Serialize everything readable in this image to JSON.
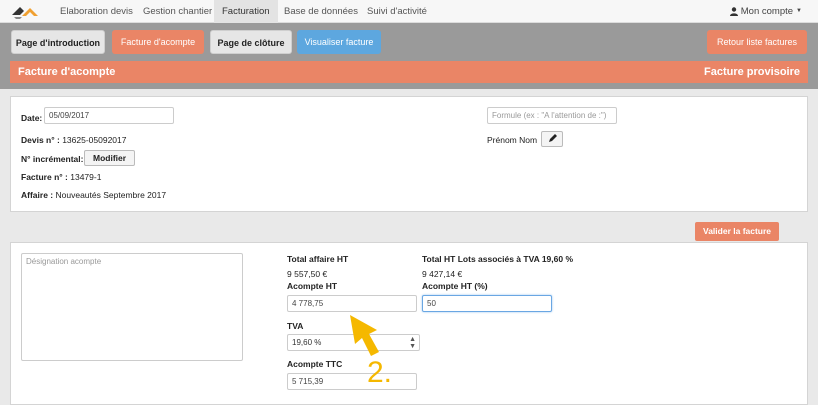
{
  "nav": {
    "tabs": [
      "Elaboration devis",
      "Gestion chantier",
      "Facturation",
      "Base de données",
      "Suivi d'activité"
    ],
    "active_index": 2,
    "account_label": "Mon compte"
  },
  "toolbar": {
    "intro": "Page d'introduction",
    "acompte": "Facture d'acompte",
    "cloture": "Page de clôture",
    "visualiser": "Visualiser facture",
    "retour": "Retour liste factures"
  },
  "title": {
    "left": "Facture d'acompte",
    "right": "Facture provisoire"
  },
  "header_form": {
    "date_label": "Date:",
    "date_value": "05/09/2017",
    "devis_label": "Devis n° :",
    "devis_value": "13625-05092017",
    "incr_label": "N° incrémental:",
    "modifier_label": "Modifier",
    "facture_label": "Facture n° :",
    "facture_value": "13479-1",
    "affaire_label": "Affaire :",
    "affaire_value": "Nouveautés Septembre 2017",
    "formule_placeholder": "Formule (ex : \"A l'attention de :\")",
    "prenom_nom": "Prénom Nom"
  },
  "validate_label": "Valider la facture",
  "acompte_form": {
    "designation_placeholder": "Désignation acompte",
    "total_affaire_label": "Total affaire HT",
    "total_affaire_value": "9 557,50 €",
    "total_lots_label": "Total HT Lots associés à TVA 19,60 %",
    "total_lots_value": "9 427,14 €",
    "acompte_ht_label": "Acompte HT",
    "acompte_ht_value": "4 778,75",
    "acompte_pct_label": "Acompte HT (%)",
    "acompte_pct_value": "50",
    "tva_label": "TVA",
    "tva_value": "19,60 %",
    "acompte_ttc_label": "Acompte TTC",
    "acompte_ttc_value": "5 715,39"
  },
  "annotation": {
    "number": "2.",
    "color": "#f5b800"
  },
  "colors": {
    "orange": "#ea8566",
    "blue": "#5da7df",
    "gray_panel": "#9a9a9a"
  }
}
